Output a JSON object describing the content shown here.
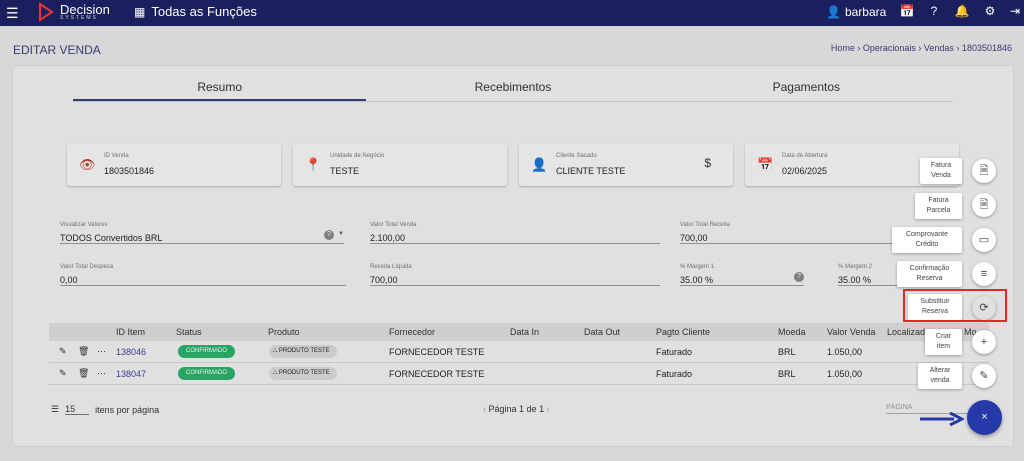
{
  "topbar": {
    "brand_line1": "Decision",
    "brand_line2": "SYSTEMS",
    "all_functions": "Todas as Funções",
    "username": "barbara",
    "icons": [
      "menu-icon",
      "calendar-icon",
      "help-icon",
      "bell-icon",
      "gear-icon",
      "logout-icon"
    ]
  },
  "header": {
    "title": "EDITAR VENDA",
    "breadcrumb": "Home › Operacionais › Vendas › 1803501846"
  },
  "tabs": [
    {
      "label": "Resumo",
      "active": true
    },
    {
      "label": "Recebimentos",
      "active": false
    },
    {
      "label": "Pagamentos",
      "active": false
    }
  ],
  "info_boxes": [
    {
      "label": "ID Venda",
      "value": "1803501846",
      "icon": "eye-icon"
    },
    {
      "label": "Unidade de Negócio",
      "value": "TESTE",
      "icon": "location-pin-icon"
    },
    {
      "label": "Cliente Sacado",
      "value": "CLIENTE TESTE",
      "icon": "person-icon"
    },
    {
      "label": "Data de Abertura",
      "value": "02/06/2025",
      "icon": "calendar-icon"
    }
  ],
  "fields": {
    "visualizar_valores": {
      "label": "Visualizar Valores",
      "value": "TODOS Convertidos BRL"
    },
    "valor_total_venda": {
      "label": "Valor Total Venda",
      "value": "2.100,00"
    },
    "valor_total_receita": {
      "label": "Valor Total Receita",
      "value": "700,00"
    },
    "valor_total_despesa": {
      "label": "Valor Total Despesa",
      "value": "0,00"
    },
    "receita_liquida": {
      "label": "Receita Líquida",
      "value": "700,00"
    },
    "margem_1": {
      "label": "% Margem 1",
      "value": "35.00 %"
    },
    "margem_2": {
      "label": "% Margem 2",
      "value": "35.00 %"
    }
  },
  "table": {
    "headers": [
      "ID Item",
      "Status",
      "Produto",
      "Fornecedor",
      "Data In",
      "Data Out",
      "Pagto Cliente",
      "Moeda",
      "Valor Venda",
      "Localizador",
      "Mo"
    ],
    "rows": [
      {
        "id": "138046",
        "status": "CONFIRMADO",
        "produto": "PRODUTO TESTE",
        "fornecedor": "FORNECEDOR TESTE",
        "pagto": "Faturado",
        "moeda": "BRL",
        "valor": "1.050,00"
      },
      {
        "id": "138047",
        "status": "CONFIRMADO",
        "produto": "PRODUTO TESTE",
        "fornecedor": "FORNECEDOR TESTE",
        "pagto": "Faturado",
        "moeda": "BRL",
        "valor": "1.050,00"
      }
    ]
  },
  "pagination": {
    "per_page": "15",
    "per_page_label": "itens por página",
    "page_label": "Página",
    "page_info": "1 de 1",
    "page_input_placeholder": "PÁGINA"
  },
  "speed_dial": [
    {
      "label_1": "Fatura",
      "label_2": "Venda",
      "icon": "document-icon"
    },
    {
      "label_1": "Fatura",
      "label_2": "Parcela",
      "icon": "document-icon"
    },
    {
      "label_1": "Comprovante",
      "label_2": "Crédito",
      "icon": "credit-card-icon"
    },
    {
      "label_1": "Confirmação",
      "label_2": "Reserva",
      "icon": "notes-icon"
    },
    {
      "label_1": "Substituir",
      "label_2": "Reserva",
      "icon": "refresh-icon"
    },
    {
      "label_1": "Criar",
      "label_2": "item",
      "icon": "plus-icon"
    },
    {
      "label_1": "Alterar",
      "label_2": "venda",
      "icon": "pencil-icon"
    }
  ],
  "fab": {
    "icon": "close-icon",
    "glyph": "×"
  },
  "colors": {
    "topbar": "#1a1f5e",
    "accent": "#2539a8",
    "confirm_badge": "#2bb06a",
    "highlight": "#e32626"
  }
}
